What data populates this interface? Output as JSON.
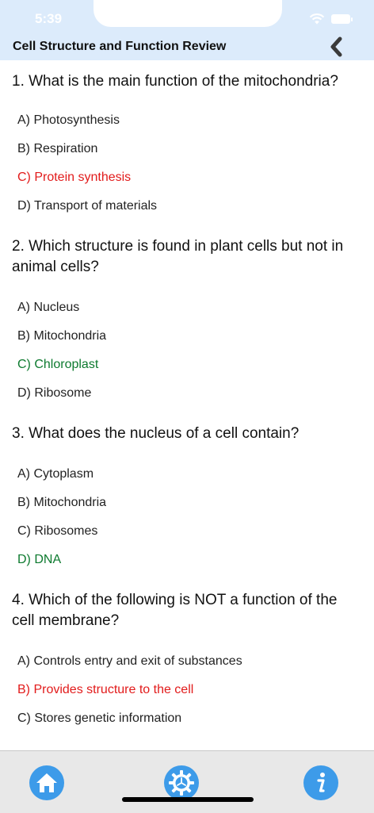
{
  "status_bar": {
    "time": "5:39"
  },
  "header": {
    "title": "Cell Structure and Function Review"
  },
  "questions": [
    {
      "text": "1. What is the main function of the mitochondria?",
      "options": [
        {
          "label": "A) Photosynthesis",
          "state": "normal"
        },
        {
          "label": "B) Respiration",
          "state": "normal"
        },
        {
          "label": "C) Protein synthesis",
          "state": "wrong"
        },
        {
          "label": "D) Transport of materials",
          "state": "normal"
        }
      ]
    },
    {
      "text": "2. Which structure is found in plant cells but not in animal cells?",
      "options": [
        {
          "label": "A) Nucleus",
          "state": "normal"
        },
        {
          "label": "B) Mitochondria",
          "state": "normal"
        },
        {
          "label": "C) Chloroplast",
          "state": "correct"
        },
        {
          "label": "D) Ribosome",
          "state": "normal"
        }
      ]
    },
    {
      "text": "3. What does the nucleus of a cell contain?",
      "options": [
        {
          "label": "A) Cytoplasm",
          "state": "normal"
        },
        {
          "label": "B) Mitochondria",
          "state": "normal"
        },
        {
          "label": "C) Ribosomes",
          "state": "normal"
        },
        {
          "label": "D) DNA",
          "state": "correct"
        }
      ]
    },
    {
      "text": "4. Which of the following is NOT a function of the cell membrane?",
      "options": [
        {
          "label": "A) Controls entry and exit of substances",
          "state": "normal"
        },
        {
          "label": "B) Provides structure to the cell",
          "state": "wrong"
        },
        {
          "label": "C) Stores genetic information",
          "state": "normal"
        }
      ]
    }
  ],
  "tabbar": {
    "items": [
      {
        "icon": "home-icon"
      },
      {
        "icon": "settings-gear-icon"
      },
      {
        "icon": "info-icon"
      }
    ]
  },
  "colors": {
    "header_bg": "#dcebfb",
    "wrong": "#e21b1b",
    "correct": "#0d7a2f",
    "tab_icon_bg": "#3d9be9"
  }
}
